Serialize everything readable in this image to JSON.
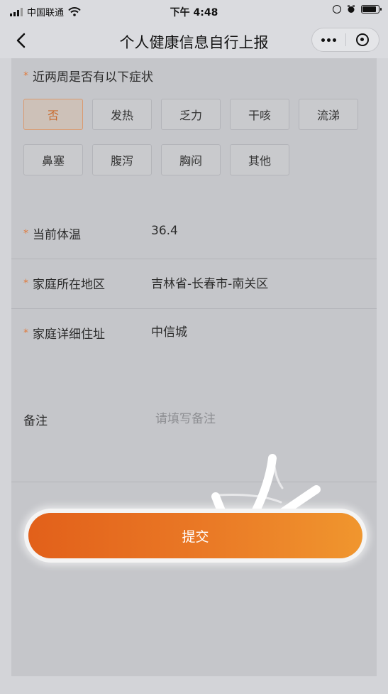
{
  "status_bar": {
    "carrier": "中国联通",
    "time": "下午 4:48"
  },
  "nav": {
    "title": "个人健康信息自行上报"
  },
  "symptoms": {
    "label": "近两周是否有以下症状",
    "options": [
      {
        "label": "否",
        "selected": true
      },
      {
        "label": "发热",
        "selected": false
      },
      {
        "label": "乏力",
        "selected": false
      },
      {
        "label": "干咳",
        "selected": false
      },
      {
        "label": "流涕",
        "selected": false
      },
      {
        "label": "鼻塞",
        "selected": false
      },
      {
        "label": "腹泻",
        "selected": false
      },
      {
        "label": "胸闷",
        "selected": false
      },
      {
        "label": "其他",
        "selected": false
      }
    ]
  },
  "form": {
    "temperature": {
      "label": "当前体温",
      "value": "36.4"
    },
    "region": {
      "label": "家庭所在地区",
      "value": "吉林省-长春市-南关区"
    },
    "address": {
      "label": "家庭详细住址",
      "value": "中信城"
    },
    "remark": {
      "label": "备注",
      "placeholder": "请填写备注"
    }
  },
  "submit": {
    "label": "提交"
  },
  "colors": {
    "accent": "#e86e22",
    "required_star": "#e07a3c",
    "selected_tag_text": "#c96b2e"
  },
  "icons": {
    "back": "chevron-left-icon",
    "menu": "more-dots-icon",
    "close": "target-icon",
    "annotation": "hand-drawn-arrow-icon"
  }
}
